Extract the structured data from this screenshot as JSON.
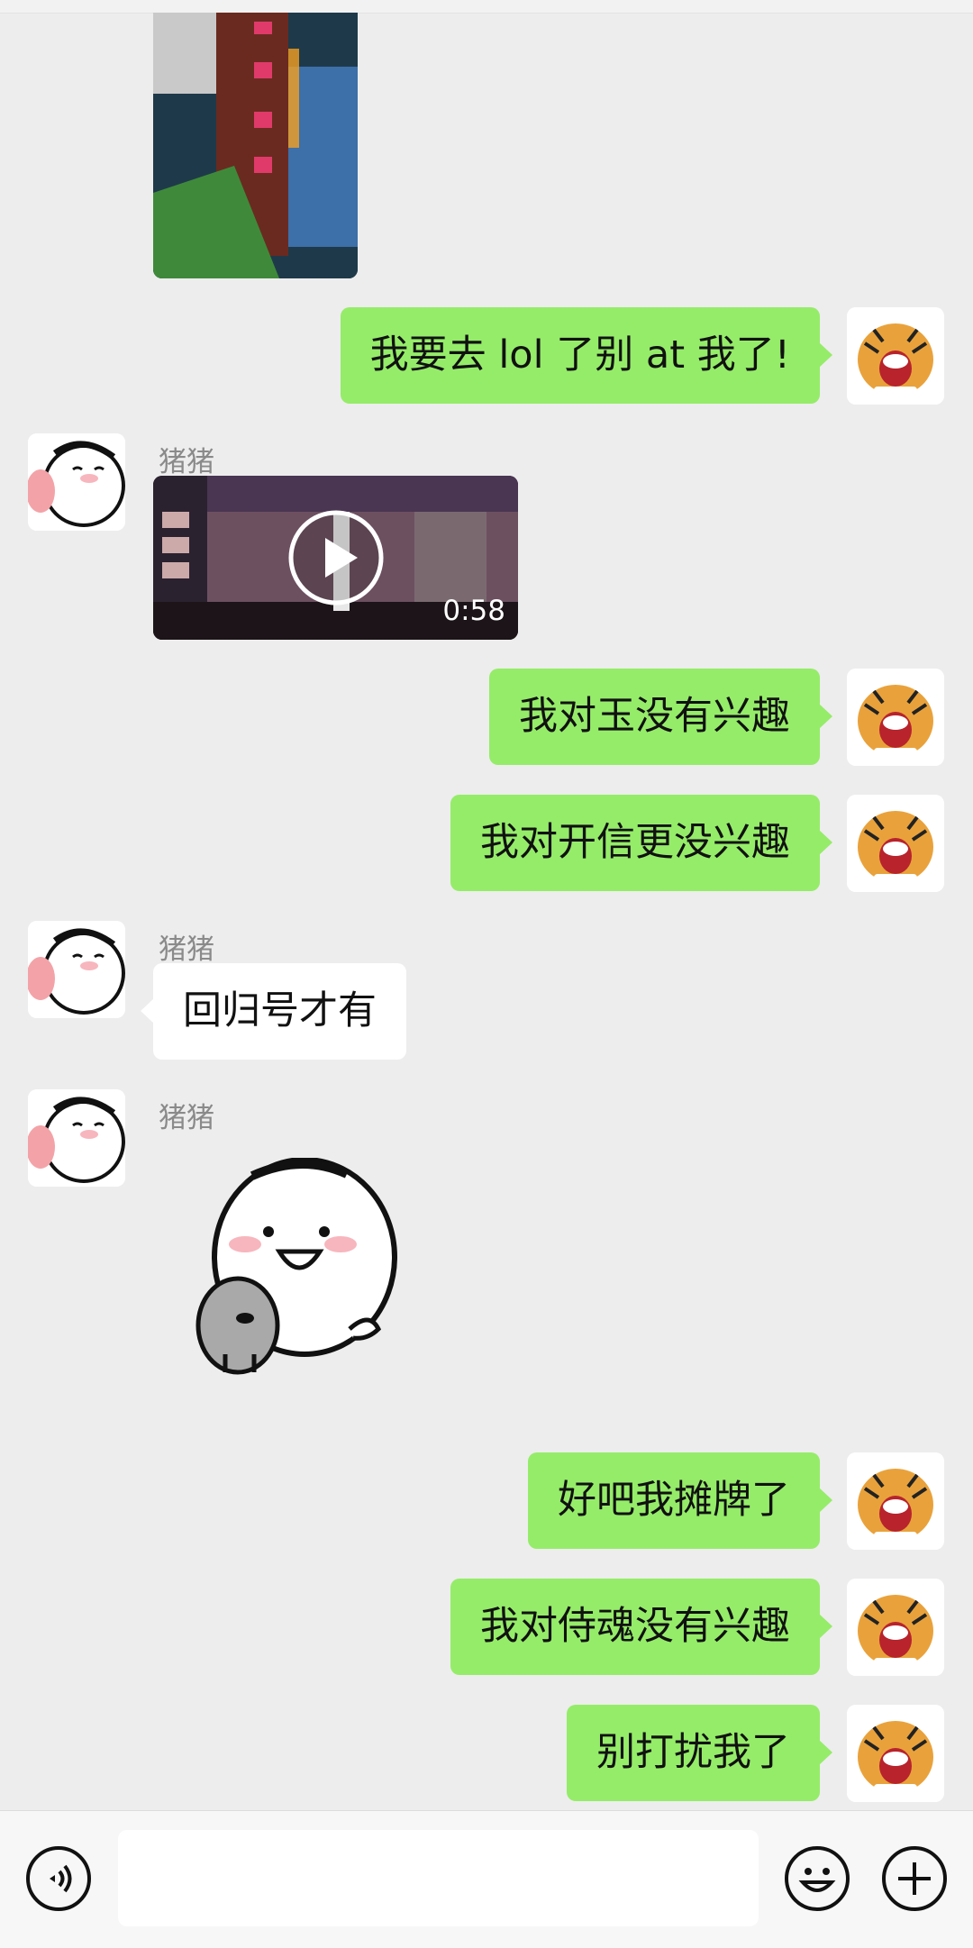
{
  "contact": {
    "name": "猪猪"
  },
  "messages": [
    {
      "type": "image",
      "side": "left"
    },
    {
      "type": "text",
      "side": "right",
      "text": "我要去 lol 了别 at 我了!"
    },
    {
      "type": "video",
      "side": "left",
      "sender": "猪猪",
      "duration": "0:58"
    },
    {
      "type": "text",
      "side": "right",
      "text": "我对玉没有兴趣"
    },
    {
      "type": "text",
      "side": "right",
      "text": "我对开信更没兴趣"
    },
    {
      "type": "text",
      "side": "left",
      "sender": "猪猪",
      "text": "回归号才有"
    },
    {
      "type": "sticker",
      "side": "left",
      "sender": "猪猪"
    },
    {
      "type": "text",
      "side": "right",
      "text": "好吧我摊牌了"
    },
    {
      "type": "text",
      "side": "right",
      "text": "我对侍魂没有兴趣"
    },
    {
      "type": "text",
      "side": "right",
      "text": "别打扰我了"
    }
  ],
  "input_bar": {
    "voice_icon": "voice-icon",
    "emoji_icon": "emoji-icon",
    "plus_icon": "plus-icon"
  },
  "colors": {
    "self_bubble": "#95ec69",
    "other_bubble": "#ffffff",
    "background": "#ededed"
  }
}
